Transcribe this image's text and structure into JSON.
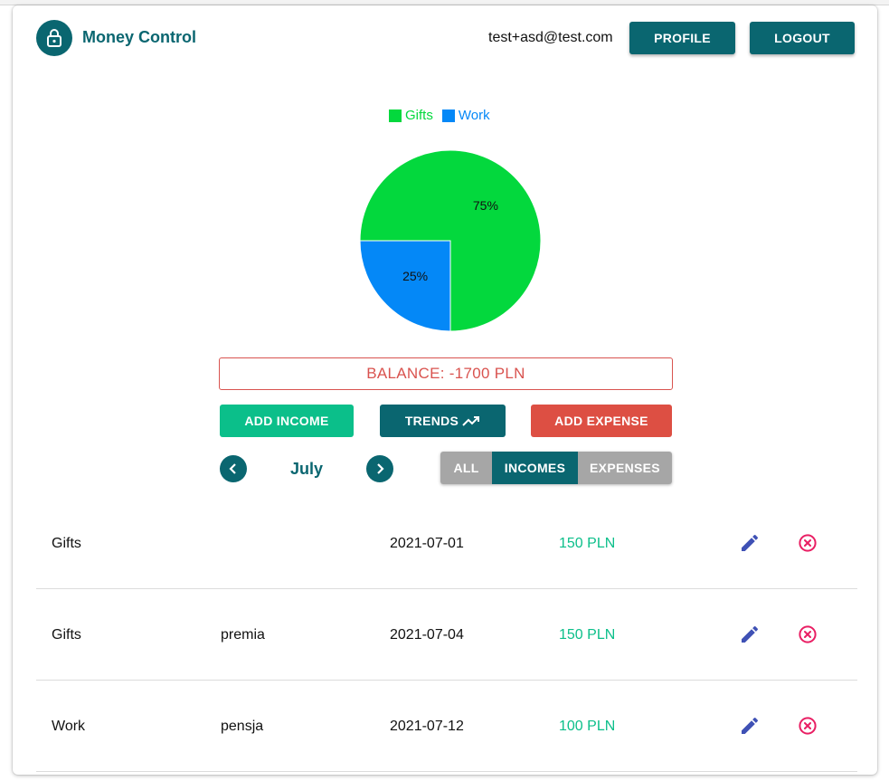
{
  "header": {
    "app_title": "Money Control",
    "user_email": "test+asd@test.com",
    "profile_label": "PROFILE",
    "logout_label": "LOGOUT",
    "logo_icon": "lock-icon"
  },
  "chart_data": {
    "type": "pie",
    "title": "",
    "legend_position": "top",
    "categories": [
      "Gifts",
      "Work"
    ],
    "values": [
      75,
      25
    ],
    "labels": [
      "75%",
      "25%"
    ],
    "colors": [
      "#03d83d",
      "#0488f7"
    ]
  },
  "balance": {
    "text": "BALANCE: -1700 PLN"
  },
  "actions": {
    "add_income_label": "ADD INCOME",
    "trends_label": "TRENDS",
    "trends_icon": "trending-up-icon",
    "add_expense_label": "ADD EXPENSE"
  },
  "month_nav": {
    "month": "July",
    "prev_icon": "chevron-left-icon",
    "next_icon": "chevron-right-icon"
  },
  "filters": {
    "all_label": "ALL",
    "incomes_label": "INCOMES",
    "expenses_label": "EXPENSES",
    "selected": "INCOMES"
  },
  "transactions": [
    {
      "category": "Gifts",
      "description": "",
      "date": "2021-07-01",
      "amount": "150 PLN"
    },
    {
      "category": "Gifts",
      "description": "premia",
      "date": "2021-07-04",
      "amount": "150 PLN"
    },
    {
      "category": "Work",
      "description": "pensja",
      "date": "2021-07-12",
      "amount": "100 PLN"
    }
  ],
  "colors": {
    "primary": "#0a6670",
    "income": "#0bbf8a",
    "expense": "#dd4f43",
    "edit_icon": "#3f51b5",
    "delete_icon": "#e91e63"
  }
}
